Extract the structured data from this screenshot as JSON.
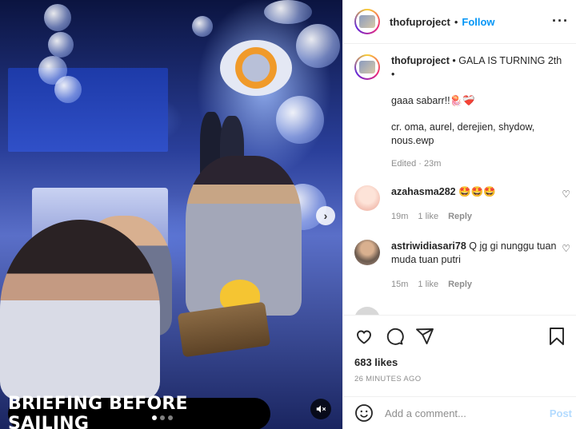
{
  "media": {
    "caption_overlay": "BRIEFING BEFORE SAILING",
    "next_icon": "chevron-right-icon",
    "mute_icon": "speaker-muted-icon"
  },
  "header": {
    "username": "thofuproject",
    "separator": "•",
    "follow_label": "Follow",
    "more_icon": "more-horizontal-icon"
  },
  "post_caption": {
    "username": "thofuproject",
    "text_line1": " • GALA IS TURNING 2th",
    "text_line2": "•",
    "text_line3": "gaaa sabarr!!🪼❤️‍🩹",
    "text_line4": "cr. oma, aurel, derejien, shydow, nous.ewp",
    "edited": "Edited · 23m"
  },
  "comments": [
    {
      "username": "azahasma282",
      "text": " 🤩🤩🤩",
      "time": "19m",
      "likes": "1 like",
      "reply": "Reply"
    },
    {
      "username": "astriwidiasari78",
      "text": " Q jg gi nunggu tuan muda tuan putri",
      "time": "15m",
      "likes": "1 like",
      "reply": "Reply"
    }
  ],
  "actions": {
    "likes": "683 likes",
    "timestamp": "26 MINUTES AGO"
  },
  "composer": {
    "placeholder": "Add a comment...",
    "post_label": "Post",
    "emoji_icon": "smiley-icon"
  },
  "colors": {
    "accent": "#0095f6",
    "muted": "#8e8e8e",
    "post_disabled": "#b3dbff"
  }
}
